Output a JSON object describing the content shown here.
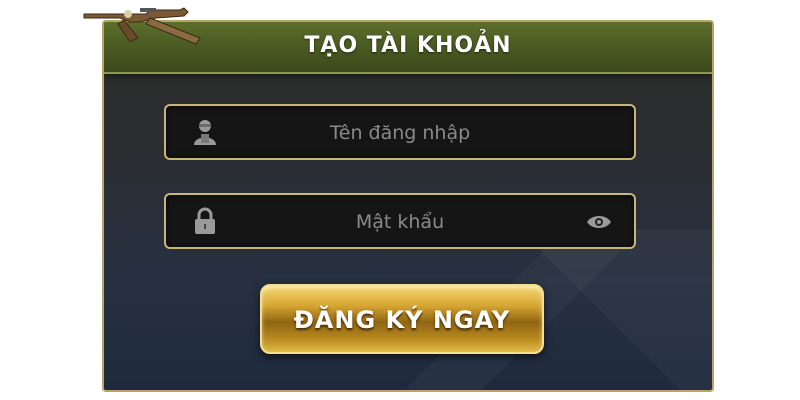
{
  "dialog": {
    "title": "TẠO TÀI KHOẢN"
  },
  "fields": {
    "username": {
      "placeholder": "Tên đăng nhập",
      "icon": "user-icon"
    },
    "password": {
      "placeholder": "Mật khẩu",
      "icon": "lock-icon",
      "toggle_icon": "eye-icon"
    }
  },
  "submit": {
    "label": "ĐĂNG KÝ NGAY"
  },
  "decoration": {
    "icon": "rifle-decoration-icon"
  },
  "colors": {
    "header": "#4a5a22",
    "border": "#c8b679",
    "button_gold": "#d6a532",
    "panel": "#2b2d31"
  }
}
